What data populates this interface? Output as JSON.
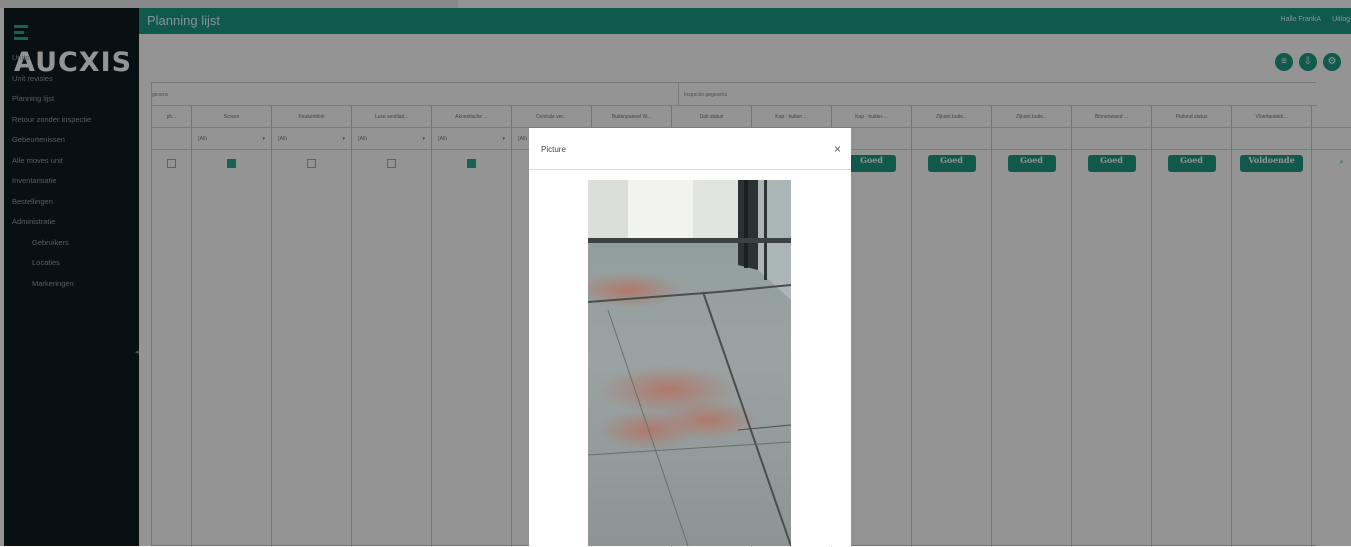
{
  "brand": {
    "logo_text": "AUCXIS"
  },
  "sidebar": {
    "items": [
      {
        "label": "Units"
      },
      {
        "label": "Unit revisies"
      },
      {
        "label": "Planning lijst"
      },
      {
        "label": "Retour zonder inspectie"
      },
      {
        "label": "Gebeurtenissen"
      },
      {
        "label": "Alle moves unit"
      },
      {
        "label": "Inventarisatie"
      },
      {
        "label": "Bestellingen"
      },
      {
        "label": "Administratie"
      },
      {
        "label": "Gebruikers"
      },
      {
        "label": "Locaties"
      },
      {
        "label": "Markeringen"
      }
    ],
    "collapse_glyph": "◂"
  },
  "header": {
    "title": "Planning lijst",
    "user": "Hallo FrankA",
    "logout": "Uitlog"
  },
  "grid": {
    "band1": "gevens",
    "band2": "Inspectie gegevens",
    "columns": [
      {
        "label": "ph...",
        "filter": "",
        "cell": "checkbox-off"
      },
      {
        "label": "Screen",
        "filter": "(All)",
        "cell": "checkbox-on"
      },
      {
        "label": "Keukenblok",
        "filter": "(All)",
        "cell": "checkbox-off"
      },
      {
        "label": "Luxe ventilati...",
        "filter": "(All)",
        "cell": "checkbox-off"
      },
      {
        "label": "Akoestische ...",
        "filter": "(All)",
        "cell": "checkbox-on"
      },
      {
        "label": "Centrale ver...",
        "filter": "(All)",
        "cell": ""
      },
      {
        "label": "Buitenpaneel W...",
        "filter": "",
        "cell": ""
      },
      {
        "label": "Dak status",
        "filter": "",
        "cell": ""
      },
      {
        "label": "Kop - buiten ...",
        "filter": "",
        "cell": ""
      },
      {
        "label": "Kop - buiten-...",
        "filter": "",
        "cell": "Goed"
      },
      {
        "label": "Zijkant buite...",
        "filter": "",
        "cell": "Goed"
      },
      {
        "label": "Zijkant buite...",
        "filter": "",
        "cell": "Goed"
      },
      {
        "label": "Binnenwand ...",
        "filter": "",
        "cell": "Goed"
      },
      {
        "label": "Plafond status",
        "filter": "",
        "cell": "Goed"
      },
      {
        "label": "Vloerbedekk...",
        "filter": "",
        "cell": "Voldoende"
      },
      {
        "label": "",
        "filter": "",
        "cell": "search"
      }
    ]
  },
  "modal": {
    "title": "Picture",
    "close": "×"
  },
  "colors": {
    "accent": "#1e9984",
    "sidebar": "#0e1d24"
  }
}
